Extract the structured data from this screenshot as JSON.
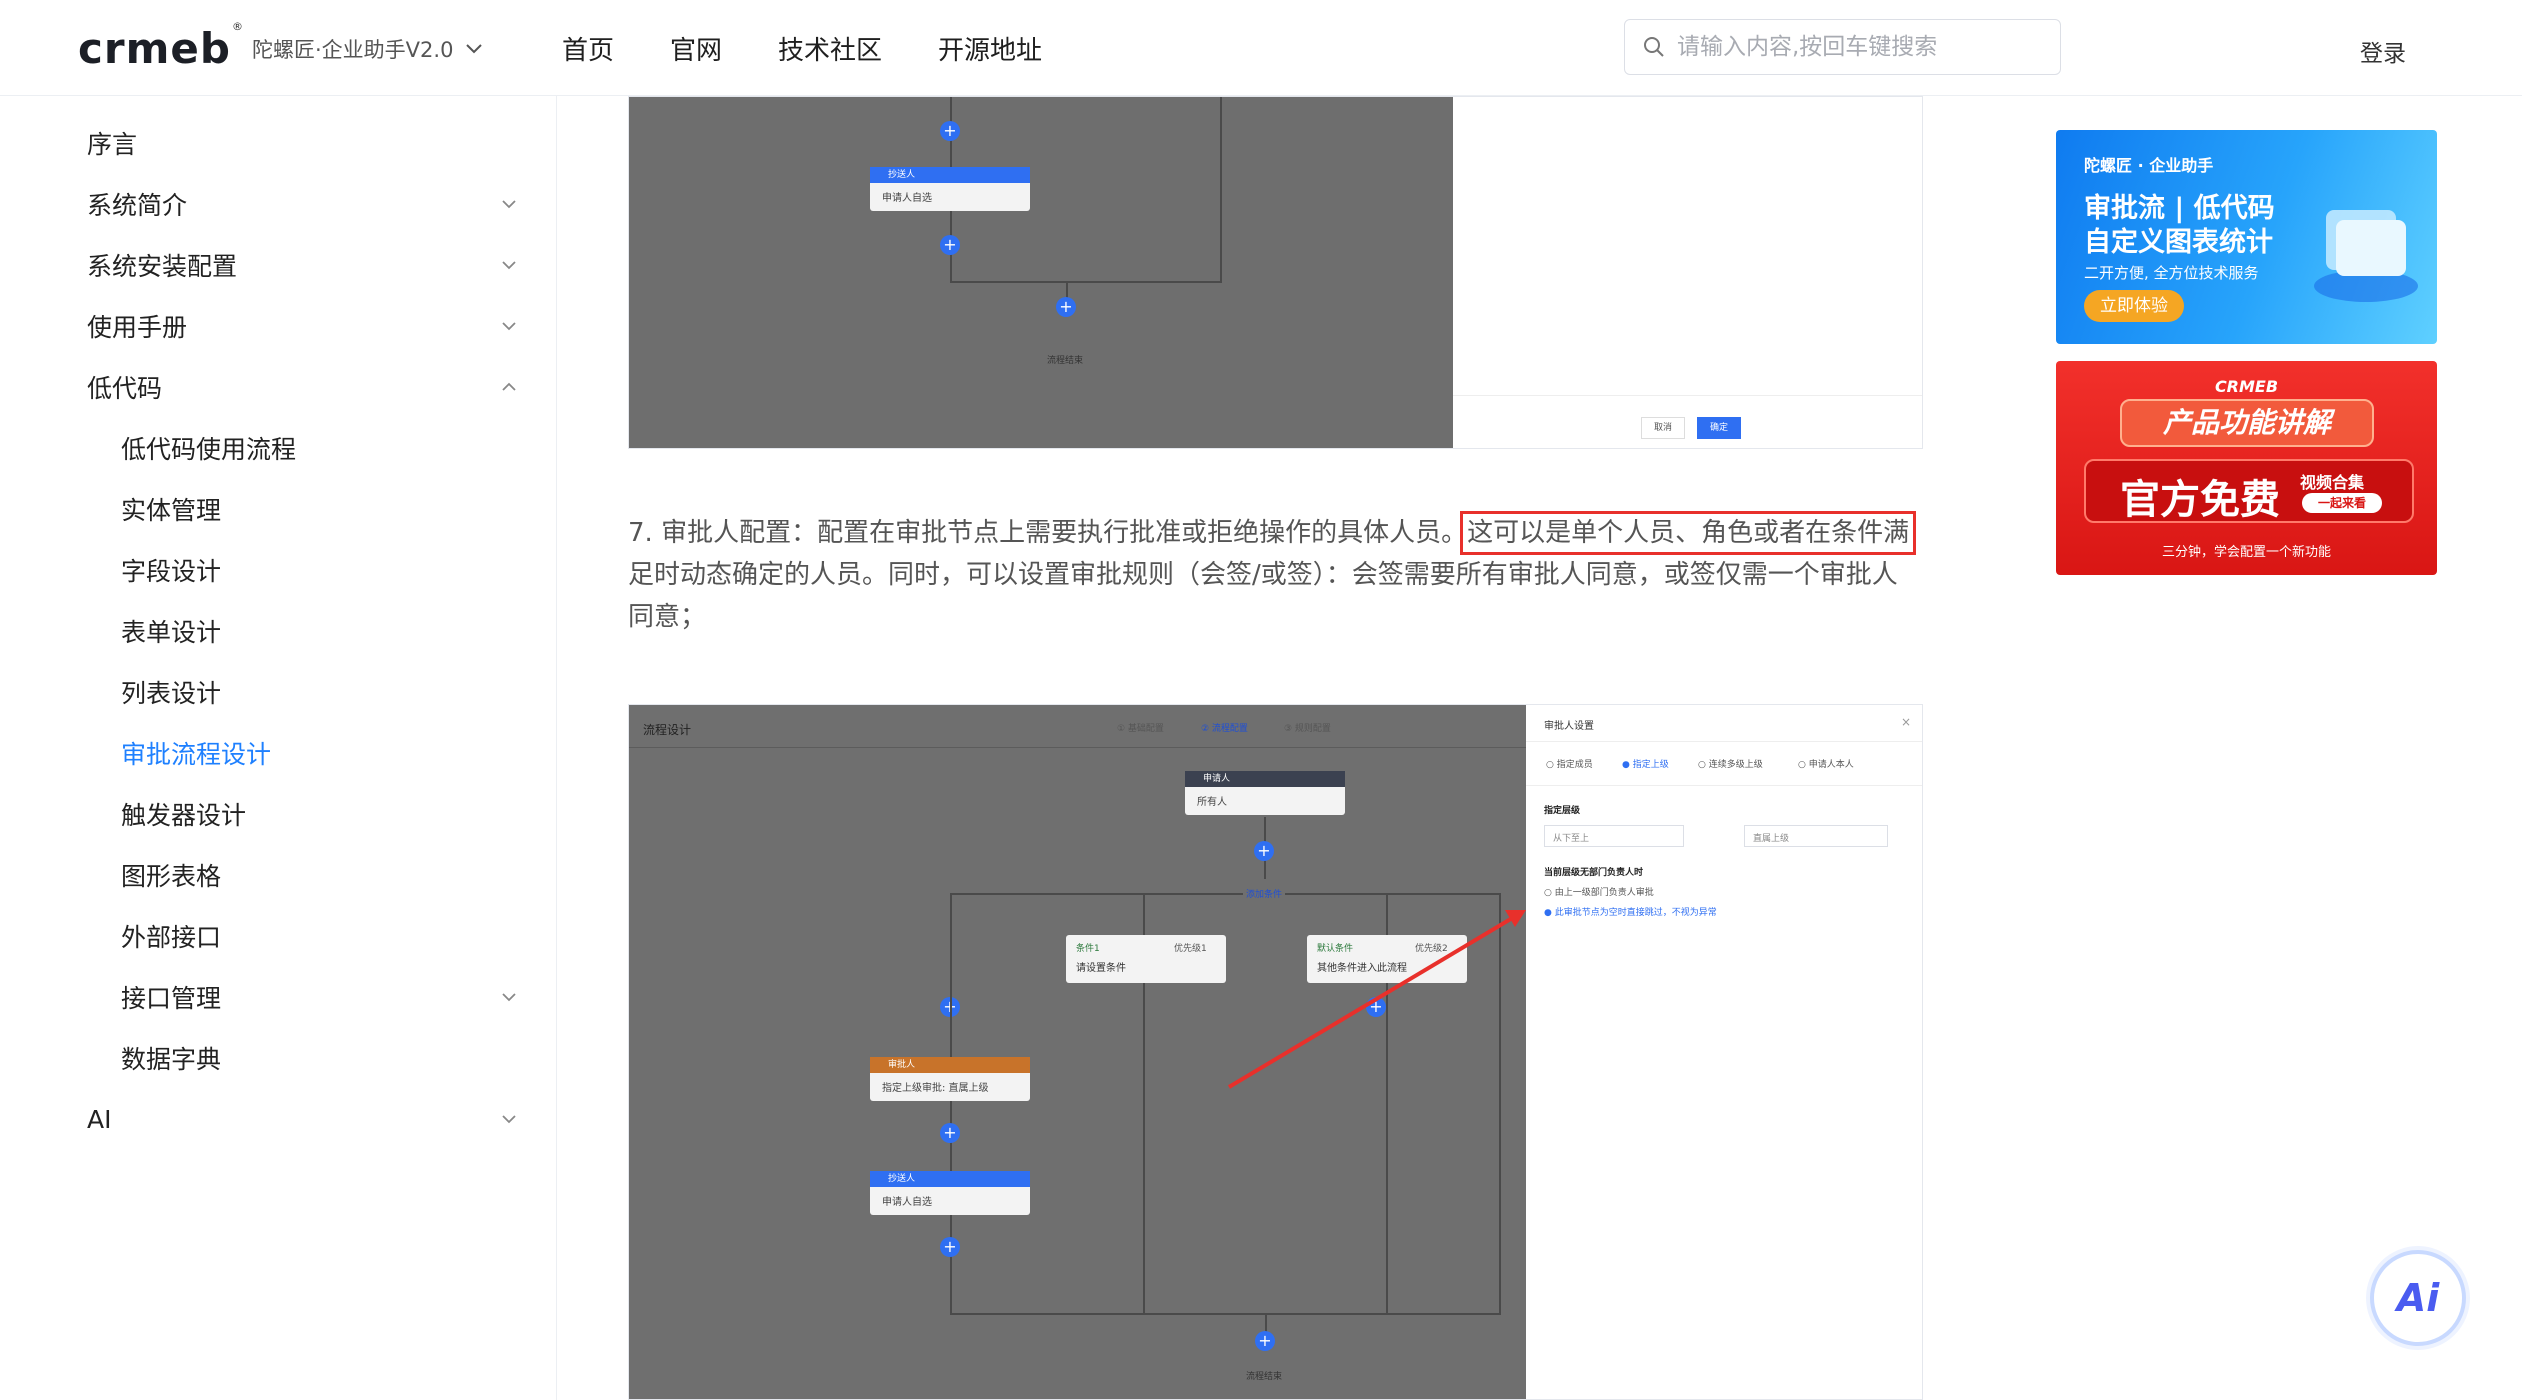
{
  "header": {
    "logo_text": "crmeb",
    "logo_reg": "®",
    "product": "陀螺匠·企业助手V2.0",
    "nav": [
      "首页",
      "官网",
      "技术社区",
      "开源地址"
    ],
    "search_placeholder": "请输入内容,按回车键搜索",
    "login": "登录"
  },
  "sidebar": {
    "items": [
      {
        "label": "序言",
        "expandable": false
      },
      {
        "label": "系统简介",
        "expandable": true
      },
      {
        "label": "系统安装配置",
        "expandable": true
      },
      {
        "label": "使用手册",
        "expandable": true
      },
      {
        "label": "低代码",
        "expandable": true,
        "expanded": true
      },
      {
        "label": "低代码使用流程",
        "child": true
      },
      {
        "label": "实体管理",
        "child": true
      },
      {
        "label": "字段设计",
        "child": true
      },
      {
        "label": "表单设计",
        "child": true
      },
      {
        "label": "列表设计",
        "child": true
      },
      {
        "label": "审批流程设计",
        "child": true,
        "active": true
      },
      {
        "label": "触发器设计",
        "child": true
      },
      {
        "label": "图形表格",
        "child": true
      },
      {
        "label": "外部接口",
        "child": true
      },
      {
        "label": "接口管理",
        "child": true,
        "expandable": true
      },
      {
        "label": "数据字典",
        "child": true
      },
      {
        "label": "AI",
        "expandable": true
      }
    ],
    "active_color": "#1e80ff"
  },
  "content": {
    "shot1": {
      "node_header": "抄送人",
      "node_body": "申请人自选",
      "end_label": "流程结束",
      "cancel": "取消",
      "confirm": "确定"
    },
    "para_prefix": "7. 审批人配置：配置在审批节点上需要执行批准或拒绝操作的具体人员。",
    "para_highlight": "这可以是单个人员、角色或者在条件满",
    "para_rest": "足时动态确定的人员。同时，可以设置审批规则（会签/或签）：会签需要所有审批人同意，或签仅需一个审批人同意；",
    "shot2": {
      "title": "流程设计",
      "steps": [
        "① 基础配置",
        "② 流程配置",
        "③ 规则配置"
      ],
      "start_node": {
        "header": "申请人",
        "body": "所有人"
      },
      "add_condition": "添加条件",
      "cond1": {
        "title": "条件1",
        "priority": "优先级1",
        "body": "请设置条件"
      },
      "cond2": {
        "title": "默认条件",
        "priority": "优先级2",
        "body": "其他条件进入此流程"
      },
      "approver_node": {
        "header": "审批人",
        "body": "指定上级审批: 直属上级"
      },
      "cc_node": {
        "header": "抄送人",
        "body": "申请人自选"
      },
      "end_label": "流程结束",
      "panel": {
        "title": "审批人设置",
        "close": "×",
        "options": [
          "指定成员",
          "指定上级",
          "连续多级上级",
          "申请人本人"
        ],
        "level_label": "指定层级",
        "select1": "从下至上",
        "select2": "直属上级",
        "no_leader_label": "当前层级无部门负责人时",
        "radio1": "由上一级部门负责人审批",
        "radio2": "此审批节点为空时直接跳过，不视为异常"
      }
    }
  },
  "ads": {
    "ad1": {
      "brand": "陀螺匠 · 企业助手",
      "line1": "审批流 | 低代码",
      "line2": "自定义图表统计",
      "sub": "二开方便, 全方位技术服务",
      "cta": "立即体验"
    },
    "ad2": {
      "brand": "CRMEB",
      "title": "产品功能讲解",
      "big": "官方免费",
      "tag1": "视频合集",
      "tag2": "一起来看",
      "footer": "三分钟，学会配置一个新功能"
    }
  },
  "ai_button": "Ai"
}
